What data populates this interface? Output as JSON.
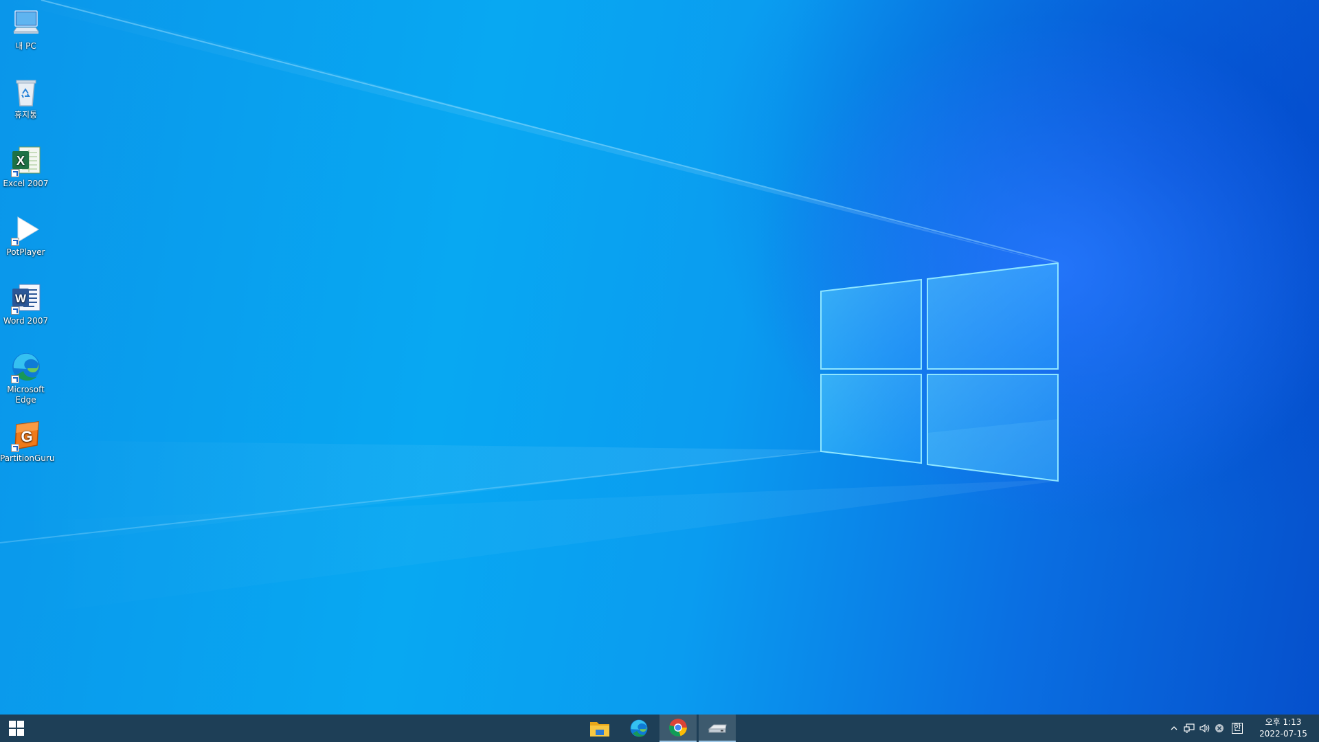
{
  "desktop": {
    "icons": [
      {
        "label": "내 PC",
        "icon": "computer-icon"
      },
      {
        "label": "휴지통",
        "icon": "recycle-bin-icon"
      },
      {
        "label": "Excel 2007",
        "icon": "excel-icon"
      },
      {
        "label": "PotPlayer",
        "icon": "potplayer-icon"
      },
      {
        "label": "Word 2007",
        "icon": "word-icon"
      },
      {
        "label": "Microsoft Edge",
        "icon": "edge-icon"
      },
      {
        "label": "PartitionGuru",
        "icon": "partitionguru-icon"
      }
    ]
  },
  "taskbar": {
    "apps": [
      {
        "name": "File Explorer",
        "icon": "folder-icon",
        "active": false
      },
      {
        "name": "Microsoft Edge",
        "icon": "edge-icon",
        "active": false
      },
      {
        "name": "Google Chrome",
        "icon": "chrome-icon",
        "active": true
      },
      {
        "name": "Drive",
        "icon": "drive-icon",
        "active": true
      }
    ],
    "tray": {
      "icons": [
        "chevron-up-icon",
        "network-icon",
        "volume-icon",
        "error-icon",
        "ime-icon"
      ],
      "ime_label": "한"
    },
    "clock": {
      "time": "오후 1:13",
      "date": "2022-07-15"
    }
  },
  "colors": {
    "taskbar": "#1e3f57",
    "wallpaper_light": "#08a8f2",
    "wallpaper_dark": "#0550cc"
  }
}
